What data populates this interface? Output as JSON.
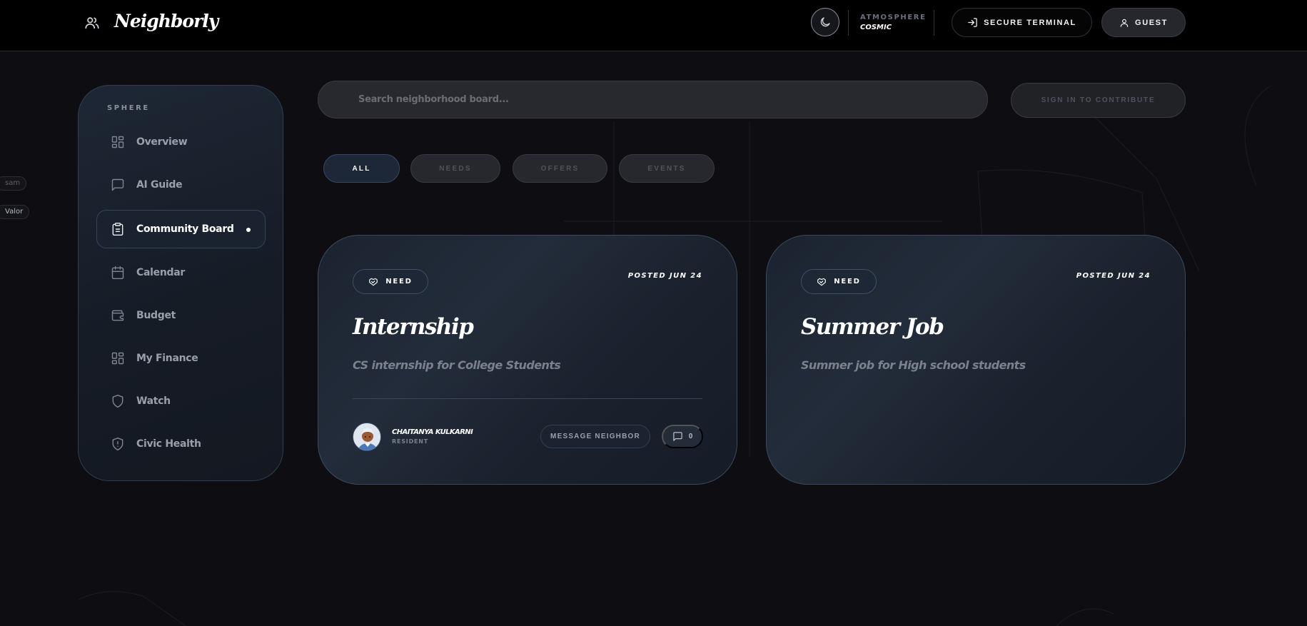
{
  "brand": {
    "name": "Neighborly",
    "icon": "users-icon"
  },
  "topbar": {
    "atmosphere_label": "ATMOSPHERE",
    "atmosphere_value": "COSMIC",
    "theme_icon": "moon-icon",
    "secure_terminal_label": "SECURE TERMINAL",
    "guest_label": "GUEST"
  },
  "edge_chips": [
    "sam",
    "Valor"
  ],
  "sidebar": {
    "section_label": "SPHERE",
    "items": [
      {
        "label": "Overview",
        "icon": "grid-icon"
      },
      {
        "label": "AI Guide",
        "icon": "chat-icon"
      },
      {
        "label": "Community Board",
        "icon": "clipboard-icon",
        "active": true
      },
      {
        "label": "Calendar",
        "icon": "calendar-icon"
      },
      {
        "label": "Budget",
        "icon": "wallet-icon"
      },
      {
        "label": "My Finance",
        "icon": "grid-icon"
      },
      {
        "label": "Watch",
        "icon": "shield-icon"
      },
      {
        "label": "Civic Health",
        "icon": "shield-alert-icon"
      }
    ]
  },
  "search": {
    "placeholder": "Search neighborhood board...",
    "value": ""
  },
  "signin_label": "SIGN IN TO CONTRIBUTE",
  "filters": [
    {
      "label": "ALL",
      "active": true
    },
    {
      "label": "NEEDS"
    },
    {
      "label": "OFFERS"
    },
    {
      "label": "EVENTS"
    }
  ],
  "posts": [
    {
      "badge": "NEED",
      "badge_icon": "handshake-icon",
      "date": "POSTED JUN 24",
      "title": "Internship",
      "description": "CS internship for College Students",
      "author": {
        "name": "CHAITANYA KULKARNI",
        "role": "RESIDENT"
      },
      "message_label": "MESSAGE NEIGHBOR",
      "comments": "0"
    },
    {
      "badge": "NEED",
      "badge_icon": "handshake-icon",
      "date": "POSTED JUN 24",
      "title": "Summer Job",
      "description": "Summer job for High school students"
    }
  ]
}
